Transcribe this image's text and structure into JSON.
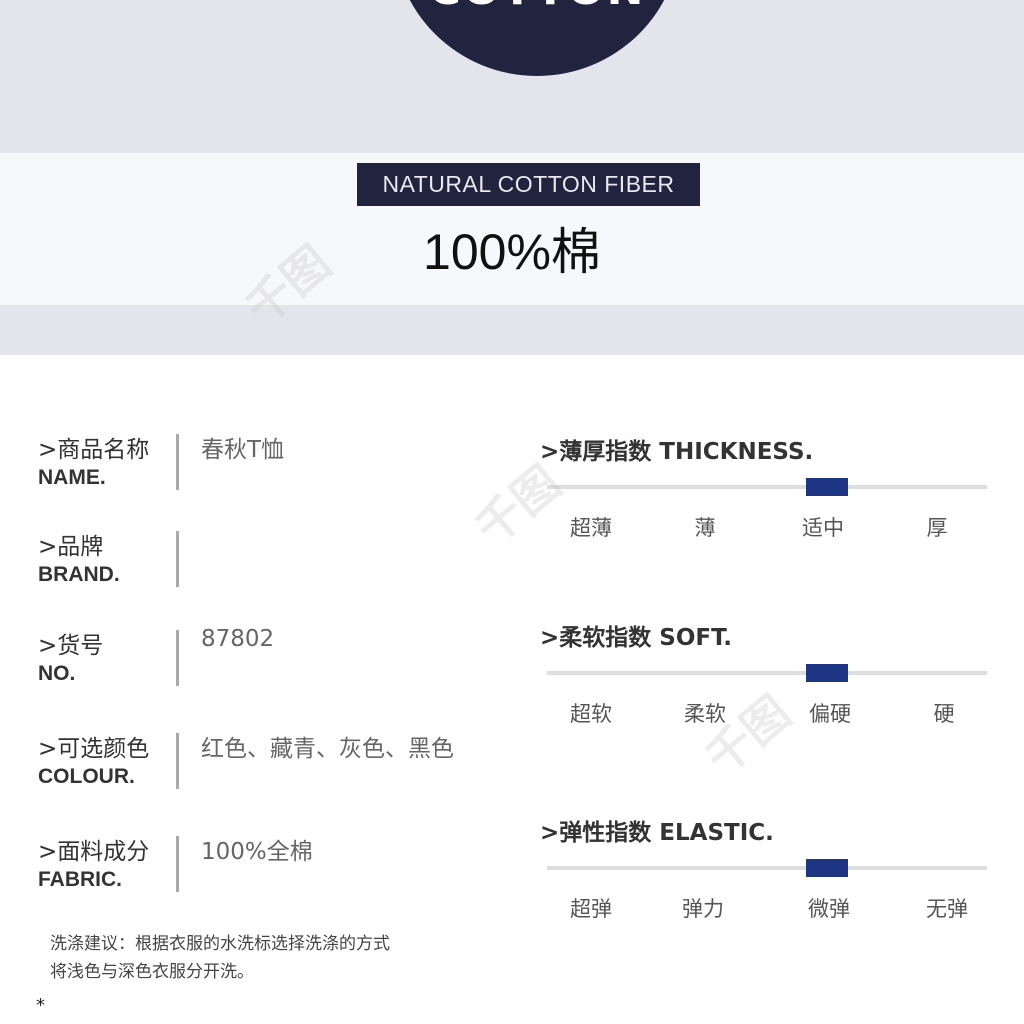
{
  "header": {
    "circle_text": "COTTON",
    "tag": "NATURAL COTTON FIBER",
    "headline": "100%棉"
  },
  "specs": [
    {
      "cn": ">商品名称",
      "en": "NAME.",
      "value": "春秋T恤"
    },
    {
      "cn": ">品牌",
      "en": "BRAND.",
      "value": ""
    },
    {
      "cn": ">货号",
      "en": "NO.",
      "value": "87802"
    },
    {
      "cn": ">可选颜色",
      "en": "COLOUR.",
      "value": "红色、藏青、灰色、黑色"
    },
    {
      "cn": ">面料成分",
      "en": "FABRIC.",
      "value": "100%全棉"
    }
  ],
  "note": {
    "line1": "洗涤建议：根据衣服的水洗标选择洗涤的方式",
    "line2": "将浅色与深色衣服分开洗。",
    "star": "*"
  },
  "scales": [
    {
      "title": ">薄厚指数 THICKNESS.",
      "labels": [
        "超薄",
        "薄",
        "适中",
        "厚"
      ],
      "selected": "适中"
    },
    {
      "title": ">柔软指数 SOFT.",
      "labels": [
        "超软",
        "柔软",
        "偏硬",
        "硬"
      ],
      "selected": "偏硬"
    },
    {
      "title": ">弹性指数 ELASTIC.",
      "labels": [
        "超弹",
        "弹力",
        "微弹",
        "无弹"
      ],
      "selected": "微弹"
    }
  ],
  "watermark": "千图",
  "colors": {
    "navy": "#21233f",
    "marker": "#1e3584",
    "bg_gray": "#e4e5ec"
  }
}
